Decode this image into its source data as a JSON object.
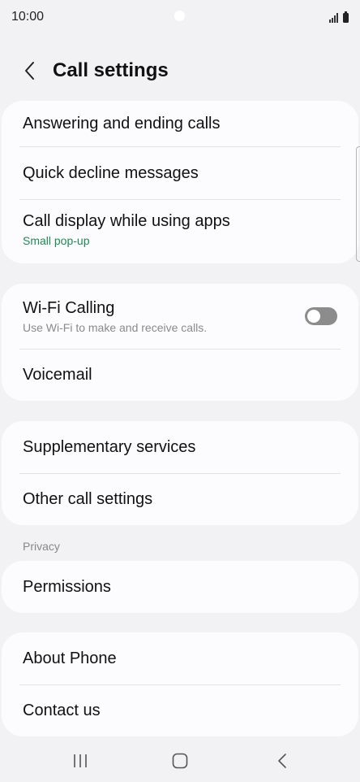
{
  "status_bar": {
    "time": "10:00"
  },
  "header": {
    "title": "Call settings"
  },
  "groups": {
    "calls": [
      {
        "title": "Answering and ending calls"
      },
      {
        "title": "Quick decline messages"
      },
      {
        "title": "Call display while using apps",
        "subtitle": "Small pop-up"
      }
    ],
    "wifi": {
      "title": "Wi-Fi Calling",
      "subtitle": "Use Wi-Fi to make and receive calls.",
      "toggle_on": false
    },
    "voicemail": {
      "title": "Voicemail"
    },
    "services": [
      {
        "title": "Supplementary services"
      },
      {
        "title": "Other call settings"
      }
    ],
    "privacy_header": "Privacy",
    "permissions": {
      "title": "Permissions"
    },
    "about": [
      {
        "title": "About Phone"
      },
      {
        "title": "Contact us"
      }
    ]
  },
  "nav_bar": {
    "icons": [
      "recents-icon",
      "home-icon",
      "back-icon"
    ]
  },
  "colors": {
    "background": "#f2f2f4",
    "card": "#fcfcfe",
    "accent_green": "#1f8a52",
    "toggle_off": "#8c8c8c"
  }
}
